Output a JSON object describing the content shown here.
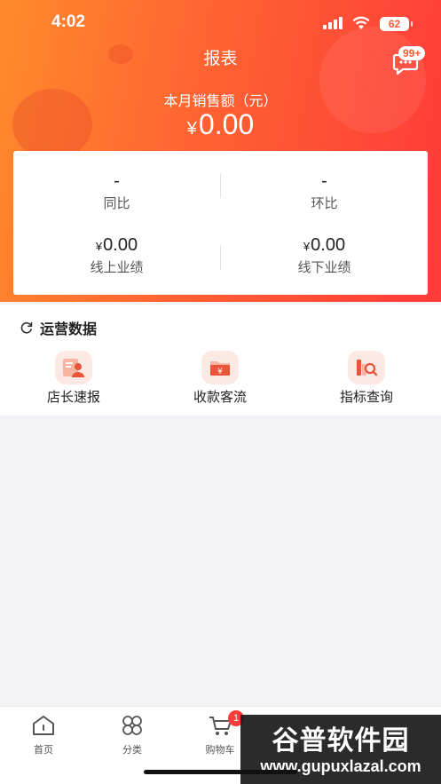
{
  "status_bar": {
    "time": "4:02",
    "battery": "62"
  },
  "header": {
    "title": "报表",
    "message_badge": "99+",
    "sales_label": "本月销售额（元）",
    "sales_currency": "¥",
    "sales_value": "0.00"
  },
  "stats": {
    "yoy": {
      "value": "-",
      "label": "同比"
    },
    "mom": {
      "value": "-",
      "label": "环比"
    },
    "online": {
      "currency": "¥",
      "value": "0.00",
      "label": "线上业绩"
    },
    "offline": {
      "currency": "¥",
      "value": "0.00",
      "label": "线下业绩"
    }
  },
  "ops": {
    "title": "运营数据",
    "items": [
      {
        "label": "店长速报",
        "icon": "manager-report-icon"
      },
      {
        "label": "收款客流",
        "icon": "payment-flow-icon"
      },
      {
        "label": "指标查询",
        "icon": "metric-query-icon"
      }
    ]
  },
  "tabbar": {
    "items": [
      {
        "label": "首页",
        "icon": "home-icon"
      },
      {
        "label": "分类",
        "icon": "category-icon"
      },
      {
        "label": "购物车",
        "icon": "cart-icon",
        "badge": "1"
      }
    ]
  },
  "watermark": {
    "title": "谷普软件园",
    "subtitle": "www.gupuxlazal.com"
  },
  "colors": {
    "accent": "#ff5a33",
    "gradient_start": "#ff8a2c",
    "gradient_end": "#ff3a3a"
  }
}
